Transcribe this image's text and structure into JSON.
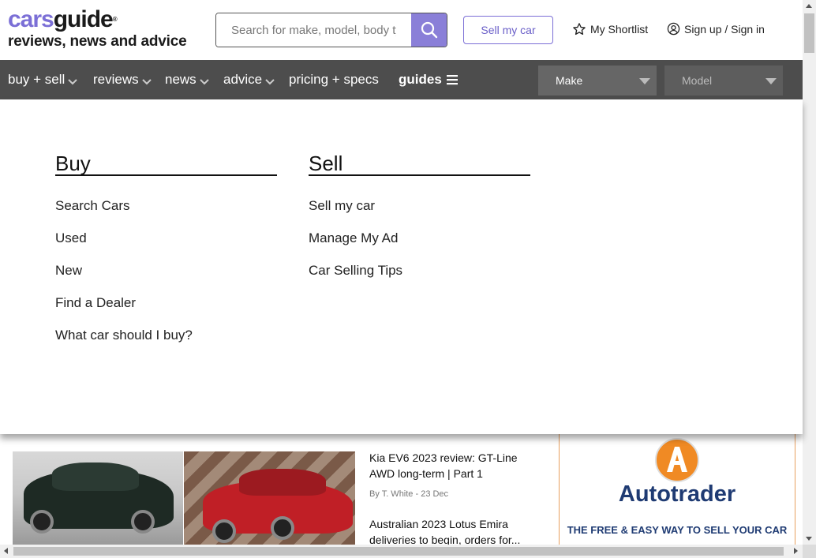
{
  "logo": {
    "cars": "cars",
    "guide": "guide",
    "reg": "®",
    "tagline": "reviews, news and advice"
  },
  "search": {
    "placeholder": "Search for make, model, body type"
  },
  "header": {
    "sell_label": "Sell my car",
    "shortlist_label": "My Shortlist",
    "signin_label": "Sign up / Sign in"
  },
  "nav": {
    "items": [
      {
        "label": "buy + sell"
      },
      {
        "label": "reviews"
      },
      {
        "label": "news"
      },
      {
        "label": "advice"
      },
      {
        "label": "pricing + specs"
      },
      {
        "label": "guides"
      }
    ],
    "make_select": "Make",
    "model_select": "Model"
  },
  "menu": {
    "buy": {
      "title": "Buy",
      "links": [
        "Search Cars",
        "Used",
        "New",
        "Find a Dealer",
        "What car should I buy?"
      ]
    },
    "sell": {
      "title": "Sell",
      "links": [
        "Sell my car",
        "Manage My Ad",
        "Car Selling Tips"
      ]
    }
  },
  "articles": [
    {
      "title": "Kia EV6 2023 review: GT-Line AWD long-term | Part 1",
      "byline": "By T. White - 23 Dec"
    },
    {
      "title": "Australian 2023 Lotus Emira deliveries to begin, orders for...",
      "byline": ""
    }
  ],
  "ad": {
    "brand": "Autotrader",
    "tagline": "THE FREE & EASY WAY TO SELL YOUR CAR"
  },
  "colors": {
    "brand_purple": "#7b6fd6",
    "nav_bg": "#4d4d4d",
    "ad_blue": "#1f3b73",
    "ad_orange": "#f08a24"
  }
}
